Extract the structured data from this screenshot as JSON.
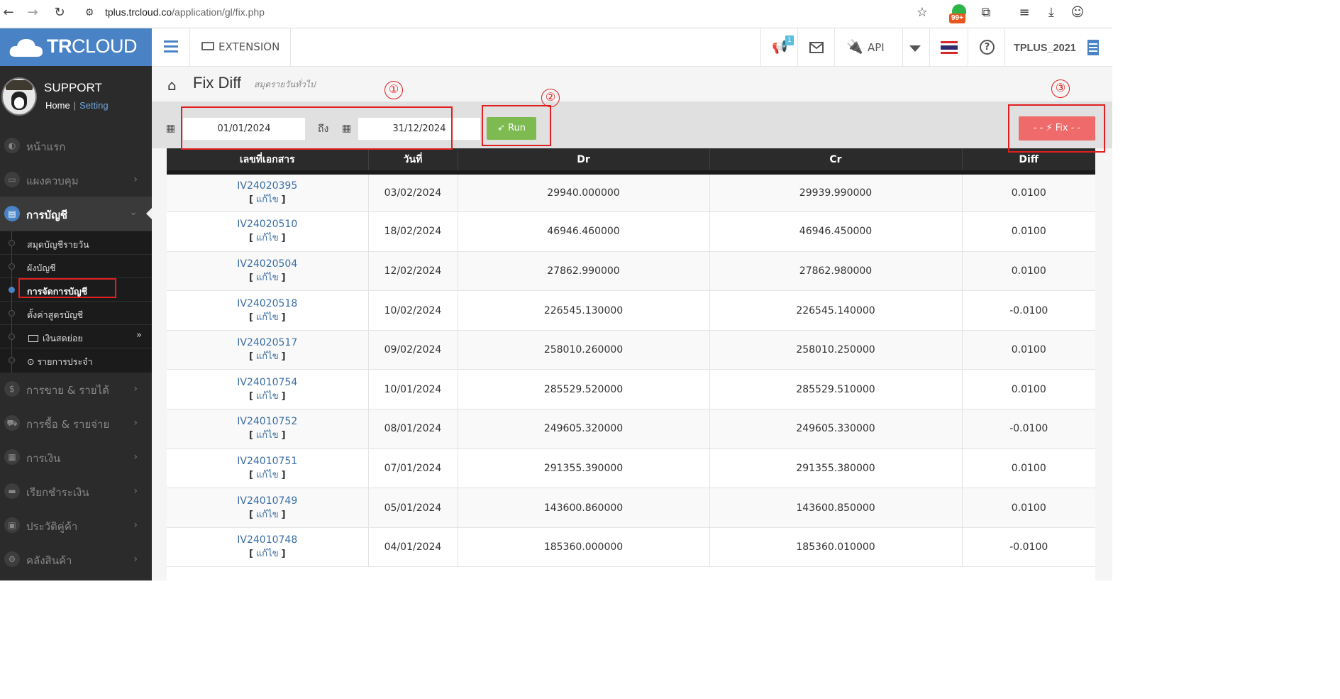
{
  "browser": {
    "url_host": "tplus.trcloud.co",
    "url_path": "/application/gl/fix.php",
    "ext_badge": "99+"
  },
  "sidebar": {
    "brand_bold": "TR",
    "brand_rest": "CLOUD",
    "profile_name": "SUPPORT",
    "profile_home": "Home",
    "profile_setting": "Setting",
    "items": [
      {
        "label": "หน้าแรก",
        "icon": "dashboard-icon"
      },
      {
        "label": "แผงควบคุม",
        "icon": "monitor-icon"
      },
      {
        "label": "การบัญชี",
        "icon": "book-icon",
        "active": true
      },
      {
        "label": "การขาย & รายได้",
        "icon": "dollar-icon"
      },
      {
        "label": "การซื้อ & รายจ่าย",
        "icon": "cart-icon"
      },
      {
        "label": "การเงิน",
        "icon": "calendar-icon"
      },
      {
        "label": "เรียกชำระเงิน",
        "icon": "credit-card-icon"
      },
      {
        "label": "ประวัติคู่ค้า",
        "icon": "contact-icon"
      },
      {
        "label": "คลังสินค้า",
        "icon": "bicycle-icon"
      }
    ],
    "sub_items": [
      {
        "label": "สมุดบัญชีรายวัน"
      },
      {
        "label": "ผังบัญชี"
      },
      {
        "label": "การจัดการบัญชี",
        "current": true
      },
      {
        "label": "ตั้งค่าสูตรบัญชี"
      },
      {
        "label": "เงินสดย่อย"
      },
      {
        "label": "รายการประจำ"
      }
    ]
  },
  "topnav": {
    "extension_label": "EXTENSION",
    "notif_count": "1",
    "api_label": "API",
    "user_label": "TPLUS_2021"
  },
  "page": {
    "title": "Fix Diff",
    "subtitle": "สมุดรายวันทั่วไป",
    "date_from": "01/01/2024",
    "to_label": "ถึง",
    "date_to": "31/12/2024",
    "run_label": "Run",
    "fix_label": "- - ⚡ Fix - -"
  },
  "annotations": [
    "①",
    "②",
    "③"
  ],
  "table": {
    "headers": [
      "เลขที่เอกสาร",
      "วันที่",
      "Dr",
      "Cr",
      "Diff"
    ],
    "edit_label": "แก้ไข",
    "rows": [
      {
        "doc": "IV24020395",
        "date": "03/02/2024",
        "dr": "29940.000000",
        "cr": "29939.990000",
        "diff": "0.0100"
      },
      {
        "doc": "IV24020510",
        "date": "18/02/2024",
        "dr": "46946.460000",
        "cr": "46946.450000",
        "diff": "0.0100"
      },
      {
        "doc": "IV24020504",
        "date": "12/02/2024",
        "dr": "27862.990000",
        "cr": "27862.980000",
        "diff": "0.0100"
      },
      {
        "doc": "IV24020518",
        "date": "10/02/2024",
        "dr": "226545.130000",
        "cr": "226545.140000",
        "diff": "-0.0100"
      },
      {
        "doc": "IV24020517",
        "date": "09/02/2024",
        "dr": "258010.260000",
        "cr": "258010.250000",
        "diff": "0.0100"
      },
      {
        "doc": "IV24010754",
        "date": "10/01/2024",
        "dr": "285529.520000",
        "cr": "285529.510000",
        "diff": "0.0100"
      },
      {
        "doc": "IV24010752",
        "date": "08/01/2024",
        "dr": "249605.320000",
        "cr": "249605.330000",
        "diff": "-0.0100"
      },
      {
        "doc": "IV24010751",
        "date": "07/01/2024",
        "dr": "291355.390000",
        "cr": "291355.380000",
        "diff": "0.0100"
      },
      {
        "doc": "IV24010749",
        "date": "05/01/2024",
        "dr": "143600.860000",
        "cr": "143600.850000",
        "diff": "0.0100"
      },
      {
        "doc": "IV24010748",
        "date": "04/01/2024",
        "dr": "185360.000000",
        "cr": "185360.010000",
        "diff": "-0.0100"
      }
    ]
  }
}
